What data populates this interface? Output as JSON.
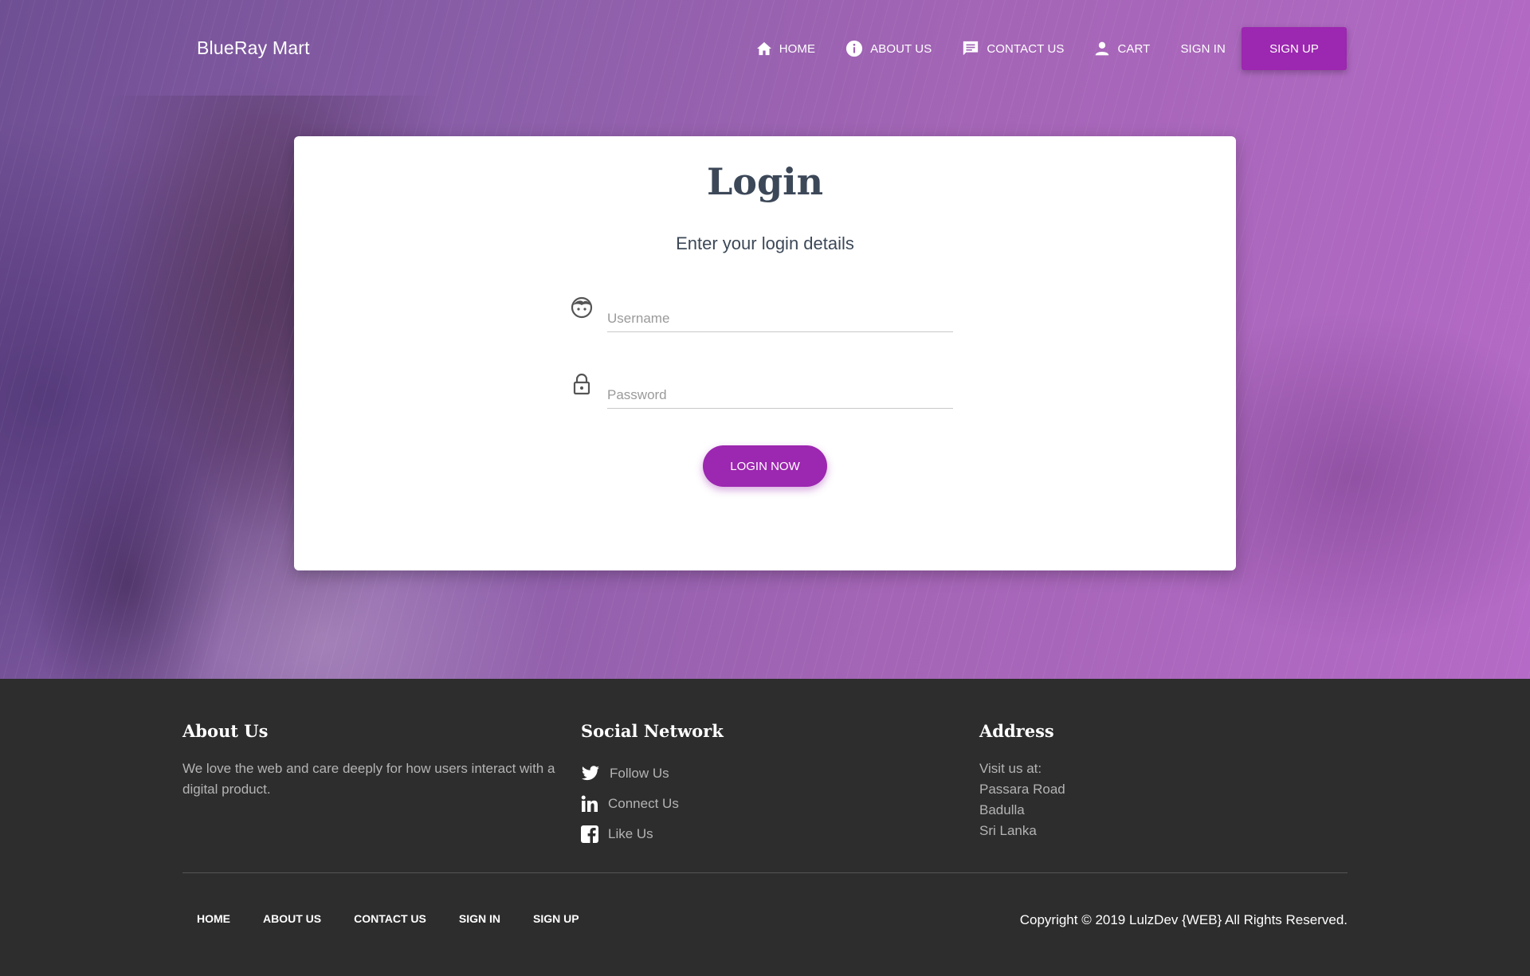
{
  "brand": "BlueRay Mart",
  "nav": {
    "home": "HOME",
    "about": "ABOUT US",
    "contact": "CONTACT US",
    "cart": "CART",
    "sign_in": "SIGN IN",
    "sign_up": "SIGN UP"
  },
  "login": {
    "title": "Login",
    "subtitle": "Enter your login details",
    "username_placeholder": "Username",
    "password_placeholder": "Password",
    "button": "LOGIN NOW"
  },
  "footer": {
    "about": {
      "heading": "About Us",
      "text": "We love the web and care deeply for how users interact with a digital product."
    },
    "social": {
      "heading": "Social Network",
      "twitter": "Follow Us",
      "linkedin": "Connect Us",
      "facebook": "Like Us"
    },
    "address": {
      "heading": "Address",
      "lines": [
        "Visit us at:",
        "Passara Road",
        "Badulla",
        "Sri Lanka"
      ]
    },
    "nav": [
      "HOME",
      "ABOUT US",
      "CONTACT US",
      "SIGN IN",
      "SIGN UP"
    ],
    "copyright": "Copyright © 2019 LulzDev {WEB} All Rights Reserved."
  },
  "colors": {
    "accent": "#9c27b0",
    "footer_bg": "#2d2d2d",
    "heading": "#3c4858"
  }
}
